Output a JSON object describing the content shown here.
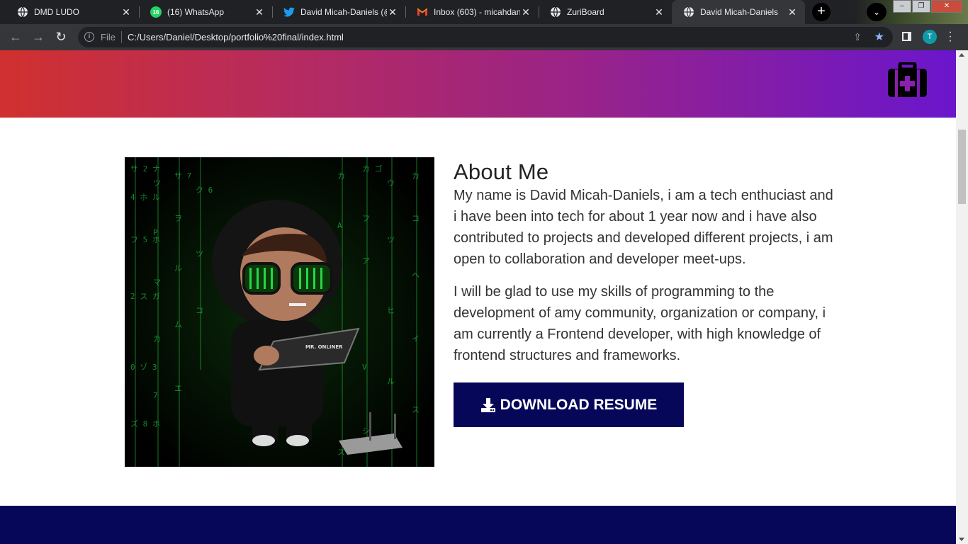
{
  "browser": {
    "tabs": [
      {
        "label": "DMD LUDO",
        "icon": "globe-icon",
        "active": false
      },
      {
        "label": "(16) WhatsApp",
        "icon": "whatsapp-icon",
        "active": false
      },
      {
        "label": "David Micah-Daniels (@",
        "icon": "twitter-icon",
        "active": false
      },
      {
        "label": "Inbox (603) - micahdan",
        "icon": "gmail-icon",
        "active": false
      },
      {
        "label": "ZuriBoard",
        "icon": "globe-icon",
        "active": false
      },
      {
        "label": "David Micah-Daniels",
        "icon": "globe-icon",
        "active": true
      }
    ],
    "whatsapp_badge": "16",
    "address": {
      "scheme_label": "File",
      "url": "C:/Users/Daniel/Desktop/portfolio%20final/index.html"
    },
    "profile_initial": "T",
    "colors": {
      "chrome_dark": "#202124",
      "toolbar": "#35363a",
      "profile": "#0e9aa7",
      "star": "#8ab4f8"
    }
  },
  "page": {
    "hero": {
      "icon": "medical-kit-icon",
      "gradient": [
        "#d0302f",
        "#9a2387",
        "#6a16cc"
      ]
    },
    "about": {
      "title": "About Me",
      "paragraph1": "My name is David Micah-Daniels, i am a tech enthuciast and i have been into tech for about 1 year now and i have also contributed to projects and developed different projects, i am open to collaboration and developer meet-ups.",
      "paragraph2": "I will be glad to use my skills of programming to the development of amy community, organization or company, i am currently a Frontend developer, with high knowledge of frontend structures and frameworks.",
      "image_laptop_text": "MR. ONLINER",
      "button_label": "DOWNLOAD RESUME",
      "button_icon": "download-icon",
      "button_color": "#07075a"
    }
  }
}
